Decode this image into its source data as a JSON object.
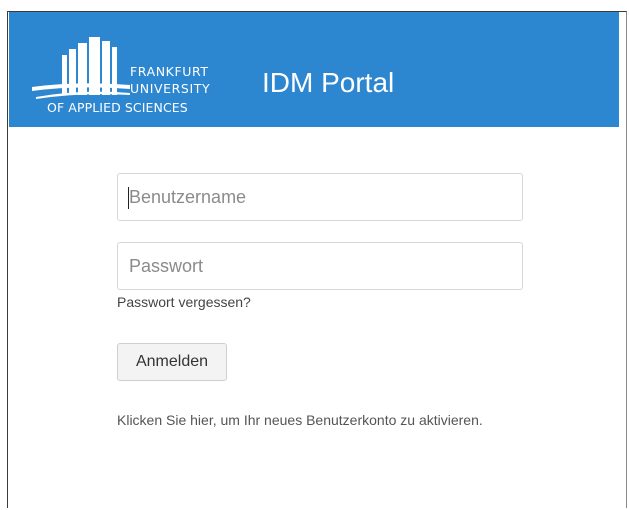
{
  "header": {
    "logo": {
      "line1": "FRANKFURT",
      "line2": "UNIVERSITY",
      "line3": "OF APPLIED SCIENCES",
      "icon": "university-building-logo"
    },
    "title": "IDM Portal",
    "background_color": "#2d86d0"
  },
  "login_form": {
    "username_placeholder": "Benutzername",
    "username_value": "",
    "password_placeholder": "Passwort",
    "password_value": "",
    "forgot_password_link": "Passwort vergessen?",
    "submit_label": "Anmelden",
    "activate_account_link": "Klicken Sie hier, um Ihr neues Benutzerkonto zu aktivieren."
  }
}
